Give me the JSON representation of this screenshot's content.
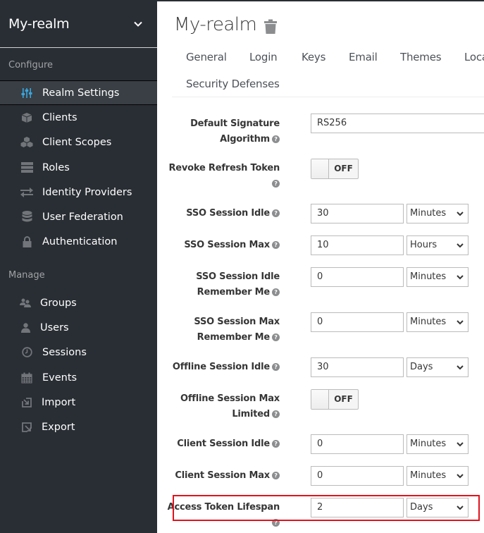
{
  "sidebar": {
    "realm_name": "My-realm",
    "sections": {
      "configure": "Configure",
      "manage": "Manage"
    },
    "configure_items": [
      {
        "label": "Realm Settings",
        "icon": "sliders-icon",
        "active": true
      },
      {
        "label": "Clients",
        "icon": "cube-icon"
      },
      {
        "label": "Client Scopes",
        "icon": "cubes-icon"
      },
      {
        "label": "Roles",
        "icon": "server-icon"
      },
      {
        "label": "Identity Providers",
        "icon": "exchange-icon"
      },
      {
        "label": "User Federation",
        "icon": "database-icon"
      },
      {
        "label": "Authentication",
        "icon": "lock-icon"
      }
    ],
    "manage_items": [
      {
        "label": "Groups",
        "icon": "users-icon"
      },
      {
        "label": "Users",
        "icon": "user-icon"
      },
      {
        "label": "Sessions",
        "icon": "clock-icon"
      },
      {
        "label": "Events",
        "icon": "calendar-icon"
      },
      {
        "label": "Import",
        "icon": "import-icon"
      },
      {
        "label": "Export",
        "icon": "export-icon"
      }
    ]
  },
  "header": {
    "title": "My-realm",
    "delete_icon": "trash-icon"
  },
  "tabs": [
    "General",
    "Login",
    "Keys",
    "Email",
    "Themes",
    "Loca",
    "Security Defenses"
  ],
  "form": {
    "default_signature_algorithm": {
      "label_line1": "Default Signature",
      "label_line2": "Algorithm",
      "value": "RS256"
    },
    "revoke_refresh_token": {
      "label": "Revoke Refresh Token",
      "state": "OFF"
    },
    "sso_session_idle": {
      "label": "SSO Session Idle",
      "value": "30",
      "unit": "Minutes"
    },
    "sso_session_max": {
      "label": "SSO Session Max",
      "value": "10",
      "unit": "Hours"
    },
    "sso_session_idle_remember_me": {
      "label_line1": "SSO Session Idle",
      "label_line2": "Remember Me",
      "value": "0",
      "unit": "Minutes"
    },
    "sso_session_max_remember_me": {
      "label_line1": "SSO Session Max",
      "label_line2": "Remember Me",
      "value": "0",
      "unit": "Minutes"
    },
    "offline_session_idle": {
      "label": "Offline Session Idle",
      "value": "30",
      "unit": "Days"
    },
    "offline_session_max_limited": {
      "label_line1": "Offline Session Max",
      "label_line2": "Limited",
      "state": "OFF"
    },
    "client_session_idle": {
      "label": "Client Session Idle",
      "value": "0",
      "unit": "Minutes"
    },
    "client_session_max": {
      "label": "Client Session Max",
      "value": "0",
      "unit": "Minutes"
    },
    "access_token_lifespan": {
      "label": "Access Token Lifespan",
      "value": "2",
      "unit": "Days"
    }
  },
  "colors": {
    "sidebar_bg": "#292e34",
    "active_icon": "#39a5dc",
    "highlight": "#e0131d"
  }
}
